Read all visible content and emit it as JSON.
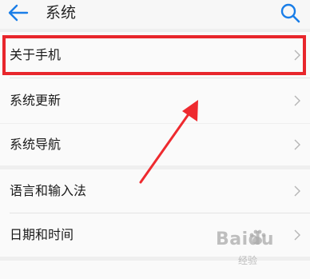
{
  "header": {
    "title": "系统",
    "back_icon": "arrow-left-icon",
    "search_icon": "search-icon"
  },
  "colors": {
    "accent": "#1a7ee8",
    "highlight": "#e8262c",
    "background": "#efefef",
    "row_bg": "#fafafa"
  },
  "settings": {
    "items": [
      {
        "label": "关于手机"
      },
      {
        "label": "系统更新"
      },
      {
        "label": "系统导航"
      },
      {
        "label": "语言和输入法"
      },
      {
        "label": "日期和时间"
      }
    ]
  },
  "watermark": {
    "brand": "Baidu",
    "sub": "经验"
  }
}
